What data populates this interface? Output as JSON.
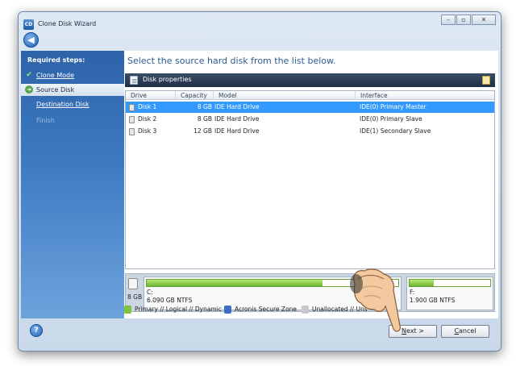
{
  "window": {
    "title": "Clone Disk Wizard",
    "app_icon_text": "CD",
    "controls": {
      "minimize": "–",
      "maximize": "▫",
      "close": "✕"
    },
    "back_glyph": "◀"
  },
  "sidebar": {
    "heading": "Required steps:",
    "items": [
      {
        "label": "Clone Mode",
        "state": "done"
      },
      {
        "label": "Source Disk",
        "state": "current"
      },
      {
        "label": "Destination Disk",
        "state": "link"
      },
      {
        "label": "Finish",
        "state": "disabled"
      }
    ]
  },
  "main": {
    "instruction": "Select the source hard disk from the list below.",
    "properties_label": "Disk properties"
  },
  "table": {
    "columns": [
      "Drive",
      "Capacity",
      "Model",
      "Interface"
    ],
    "rows": [
      {
        "drive": "Disk 1",
        "capacity": "8 GB",
        "model": "IDE Hard Drive",
        "interface": "IDE(0) Primary Master",
        "selected": true
      },
      {
        "drive": "Disk 2",
        "capacity": "8 GB",
        "model": "IDE Hard Drive",
        "interface": "IDE(0) Primary Slave",
        "selected": false
      },
      {
        "drive": "Disk 3",
        "capacity": "12 GB",
        "model": "IDE Hard Drive",
        "interface": "IDE(1) Secondary Slave",
        "selected": false
      }
    ]
  },
  "disk_map": {
    "size": "8 GB",
    "partitions": [
      {
        "letter": "C:",
        "info": "6.090 GB  NTFS",
        "used_fraction": 0.7
      },
      {
        "letter": "F:",
        "info": "1.900 GB  NTFS",
        "used_fraction": 0.3
      }
    ]
  },
  "legend": {
    "items": [
      {
        "label": "Primary // Logical // Dynamic",
        "color": "#7cc43a"
      },
      {
        "label": "Acronis Secure Zone",
        "color": "#3a6fc4"
      },
      {
        "label": "Unallocated // Uns",
        "color": "#c8c8c8"
      }
    ]
  },
  "footer": {
    "help_glyph": "?",
    "next_label": "ext >",
    "next_prefix": "N",
    "cancel_label": "ancel",
    "cancel_prefix": "C"
  }
}
